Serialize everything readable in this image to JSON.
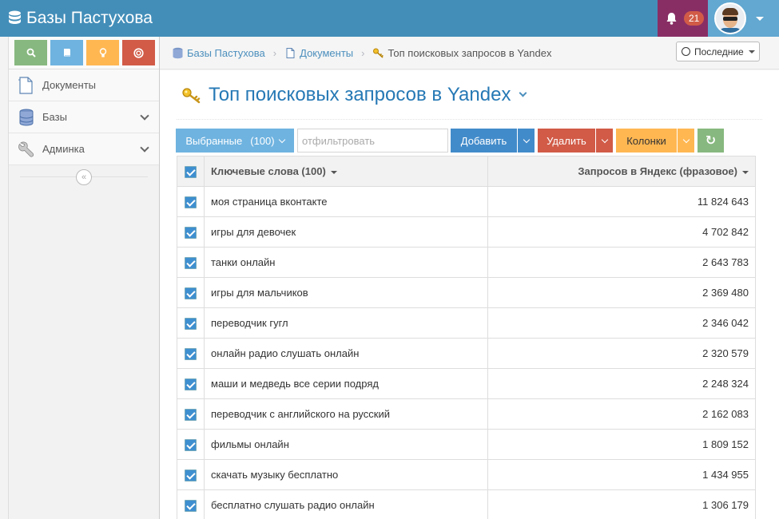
{
  "app": {
    "title": "Базы Пастухова"
  },
  "notifications": {
    "count": "21"
  },
  "sidebar": {
    "shortcuts": [
      "search-icon",
      "book-icon",
      "lightbulb-icon",
      "lifebuoy-icon"
    ],
    "items": [
      {
        "label": "Документы",
        "icon": "document-icon"
      },
      {
        "label": "Базы",
        "icon": "database-icon"
      },
      {
        "label": "Админка",
        "icon": "wrench-icon"
      }
    ],
    "collapse_glyph": "«"
  },
  "breadcrumbs": {
    "items": [
      "Базы Пастухова",
      "Документы",
      "Топ поисковых запросов в Yandex"
    ],
    "separator": "›",
    "recent_label": "Последние"
  },
  "page": {
    "title": "Топ поисковых запросов в Yandex"
  },
  "toolbar": {
    "selected_label": "Выбранные",
    "selected_count": "(100)",
    "filter_placeholder": "отфильтровать",
    "add_label": "Добавить",
    "delete_label": "Удалить",
    "columns_label": "Колонки",
    "refresh_glyph": "↻"
  },
  "table": {
    "columns": [
      "Ключевые слова (100)",
      "Запросов в Яндекс (фразовое)"
    ],
    "rows": [
      {
        "keyword": "моя страница вконтакте",
        "count": "11 824 643",
        "checked": true
      },
      {
        "keyword": "игры для девочек",
        "count": "4 702 842",
        "checked": true
      },
      {
        "keyword": "танки онлайн",
        "count": "2 643 783",
        "checked": true
      },
      {
        "keyword": "игры для мальчиков",
        "count": "2 369 480",
        "checked": true
      },
      {
        "keyword": "переводчик гугл",
        "count": "2 346 042",
        "checked": true
      },
      {
        "keyword": "онлайн радио слушать онлайн",
        "count": "2 320 579",
        "checked": true
      },
      {
        "keyword": "маши и медведь все серии подряд",
        "count": "2 248 324",
        "checked": true
      },
      {
        "keyword": "переводчик с английского на русский",
        "count": "2 162 083",
        "checked": true
      },
      {
        "keyword": "фильмы онлайн",
        "count": "1 809 152",
        "checked": true
      },
      {
        "keyword": "скачать музыку бесплатно",
        "count": "1 434 955",
        "checked": true
      },
      {
        "keyword": "бесплатно слушать радио онлайн",
        "count": "1 306 179",
        "checked": true
      }
    ]
  },
  "colors": {
    "navbar": "#438eb9",
    "accent_blue": "#2679b5",
    "add": "#428bca",
    "delete": "#d15b47",
    "columns": "#ffb752",
    "refresh": "#87b87f",
    "selected": "#6fb3e0"
  }
}
